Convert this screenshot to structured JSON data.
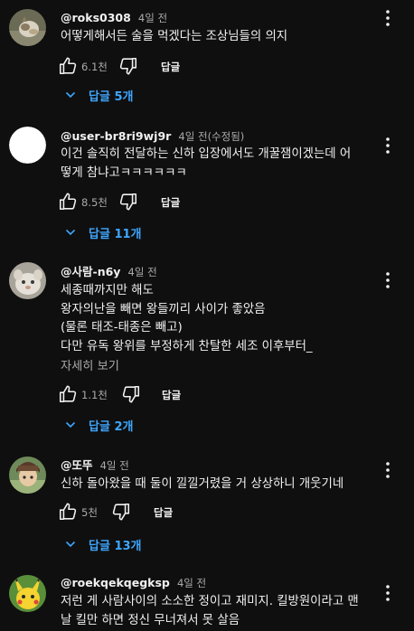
{
  "comments": [
    {
      "author": "@roks0308",
      "time": "4일 전",
      "edited": "",
      "text": [
        "어떻게해서든 술을 먹겠다는 조상님들의 의지"
      ],
      "likes": "6.1천",
      "reply_label": "답글",
      "replies_label": "답글 5개",
      "avatar": "cat-photo-avatar"
    },
    {
      "author": "@user-br8ri9wj9r",
      "time": "4일 전",
      "edited": "(수정됨)",
      "text": [
        "이건 솔직히 전달하는 신하 입장에서도 개꿀잼이겠는데 어",
        "떻게 참냐고ㅋㅋㅋㅋㅋㅋ"
      ],
      "likes": "8.5천",
      "reply_label": "답글",
      "replies_label": "답글 11개",
      "avatar": "white-circle-avatar"
    },
    {
      "author": "@사람-n6y",
      "time": "4일 전",
      "edited": "",
      "text": [
        "세종때까지만 해도",
        "왕자의난을 빼면 왕들끼리 사이가 좋았음",
        "(물론 태조-태종은 빼고)",
        "다만 유독 왕위를 부정하게 찬탈한 세조 이후부터_"
      ],
      "more_label": "자세히 보기",
      "likes": "1.1천",
      "reply_label": "답글",
      "replies_label": "답글 2개",
      "avatar": "animal-photo-avatar"
    },
    {
      "author": "@또뚜",
      "time": "4일 전",
      "edited": "",
      "text": [
        "신하 돌아왔을 때 둘이 낄낄거렸을 거 상상하니 개웃기네"
      ],
      "likes": "5천",
      "reply_label": "답글",
      "replies_label": "답글 13개",
      "avatar": "anime-character-avatar"
    },
    {
      "author": "@roekqekqegksp",
      "time": "4일 전",
      "edited": "",
      "text": [
        "저런 게 사람사이의 소소한 정이고 재미지. 킬방원이라고 맨",
        "날 킬만 하면 정신 무너져서 못 살음"
      ],
      "avatar": "pikachu-avatar"
    }
  ],
  "colors": {
    "background": "#0f0f0f",
    "text": "#f1f1f1",
    "secondary": "#aaaaaa",
    "link": "#3ea6ff"
  }
}
